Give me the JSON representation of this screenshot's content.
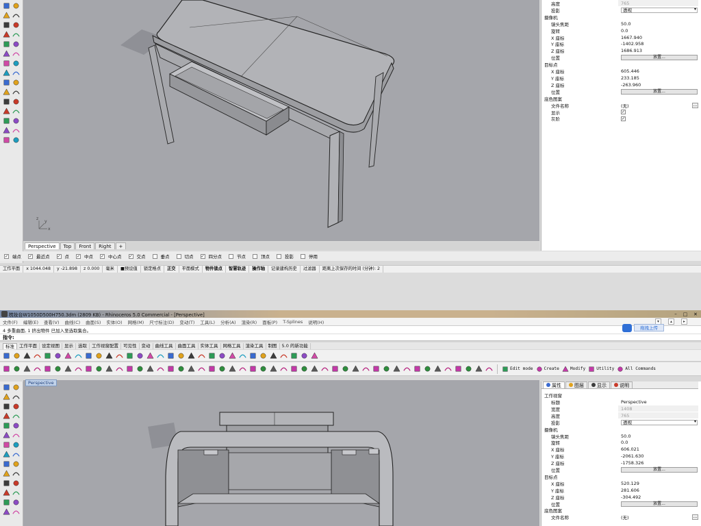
{
  "top": {
    "props": {
      "rows_top": [
        {
          "k": "高度",
          "v": "765",
          "muted": true
        },
        {
          "k": "投影",
          "v": "透视",
          "type": "dropdown"
        }
      ],
      "camera_title": "摄像机",
      "camera": [
        {
          "k": "镜头焦距",
          "v": "50.0"
        },
        {
          "k": "旋转",
          "v": "0.0"
        },
        {
          "k": "X 座标",
          "v": "1667.940"
        },
        {
          "k": "Y 座标",
          "v": "-1402.958"
        },
        {
          "k": "Z 座标",
          "v": "1686.913"
        },
        {
          "k": "位置",
          "v": "放置...",
          "type": "button"
        }
      ],
      "target_title": "目标点",
      "target": [
        {
          "k": "X 座标",
          "v": "605.446"
        },
        {
          "k": "Y 座标",
          "v": "233.185"
        },
        {
          "k": "Z 座标",
          "v": "-263.960"
        },
        {
          "k": "位置",
          "v": "放置...",
          "type": "button"
        }
      ],
      "wallpaper_title": "底色图案",
      "wallpaper": [
        {
          "k": "文件名称",
          "v": "(无)",
          "type": "file"
        },
        {
          "k": "显示",
          "v": "✓",
          "type": "check"
        },
        {
          "k": "灰阶",
          "v": "✓",
          "type": "check"
        }
      ]
    },
    "viewport_tabs": [
      "Perspective",
      "Top",
      "Front",
      "Right",
      "+"
    ],
    "snaps": [
      "端点",
      "最近点",
      "点",
      "中点",
      "中心点",
      "交点",
      "垂点",
      "切点",
      "四分点",
      "节点",
      "顶点",
      "投影",
      "停用"
    ],
    "snaps_checked": [
      true,
      true,
      true,
      true,
      true,
      true,
      false,
      false,
      true,
      false,
      false,
      false,
      false
    ],
    "status": [
      "工作平面",
      "x 1044.048",
      "y -21.898",
      "z 0.000",
      "毫米",
      "■预设值",
      "锁定格点",
      "正交",
      "平面模式",
      "物件锁点",
      "智慧轨迹",
      "操作轴",
      "记录建构历史",
      "过滤器",
      "距离上次保存的时间 (分钟): 2"
    ],
    "status_bold": [
      false,
      false,
      false,
      false,
      false,
      false,
      false,
      true,
      false,
      true,
      true,
      true,
      false,
      false,
      false
    ]
  },
  "bottom": {
    "title": "梳妆台W1050D500H750.3dm (2809 KB) - Rhinoceros 5.0 Commercial - [Perspective]",
    "menu": [
      "文件(F)",
      "编辑(E)",
      "查看(V)",
      "曲线(C)",
      "曲面(S)",
      "实体(O)",
      "网格(M)",
      "尺寸标注(D)",
      "变动(T)",
      "工具(L)",
      "分析(A)",
      "渲染(R)",
      "面板(P)",
      "T-Splines",
      "说明(H)"
    ],
    "history": "4 多重曲面, 1 挤出物件 已加入至选取集合。",
    "command_label": "指令:",
    "upload_label": "拖拽上传",
    "group_tabs": [
      "标准",
      "工作平面",
      "设定视图",
      "显示",
      "选取",
      "工作视窗配置",
      "可见性",
      "变动",
      "曲线工具",
      "曲面工具",
      "实体工具",
      "网格工具",
      "渲染工具",
      "制图",
      "5.0 的新功能"
    ],
    "tsplines_items": [
      "Edit mode",
      "Create",
      "Modify",
      "Utility",
      "All Commands"
    ],
    "viewport_label": "Perspective",
    "panel_tabs": [
      "属性",
      "图层",
      "显示",
      "说明"
    ],
    "props": {
      "viewport_title": "工作视窗",
      "viewport": [
        {
          "k": "标题",
          "v": "Perspective"
        },
        {
          "k": "宽度",
          "v": "1408",
          "muted": true
        },
        {
          "k": "高度",
          "v": "765",
          "muted": true
        },
        {
          "k": "投影",
          "v": "透视",
          "type": "dropdown"
        }
      ],
      "camera_title": "摄像机",
      "camera": [
        {
          "k": "镜头焦距",
          "v": "50.0"
        },
        {
          "k": "旋转",
          "v": "0.0"
        },
        {
          "k": "X 座标",
          "v": "606.021"
        },
        {
          "k": "Y 座标",
          "v": "-2061.630"
        },
        {
          "k": "Z 座标",
          "v": "-1758.326"
        },
        {
          "k": "位置",
          "v": "放置...",
          "type": "button"
        }
      ],
      "target_title": "目标点",
      "target": [
        {
          "k": "X 座标",
          "v": "520.129"
        },
        {
          "k": "Y 座标",
          "v": "281.606"
        },
        {
          "k": "Z 座标",
          "v": "-304.492"
        },
        {
          "k": "位置",
          "v": "放置...",
          "type": "button"
        }
      ],
      "wallpaper_title": "底色图案",
      "wallpaper": [
        {
          "k": "文件名称",
          "v": "(无)",
          "type": "file"
        }
      ]
    }
  },
  "colors": {
    "viewport_bg": "#a5a6ab",
    "panel_bg": "#ffffff",
    "toolbar_bg": "#e9e9e9",
    "titlebar_top": "#7a8cab",
    "titlebar_bottom": "#c9b18e",
    "accent_blue": "#2f6fd6"
  }
}
